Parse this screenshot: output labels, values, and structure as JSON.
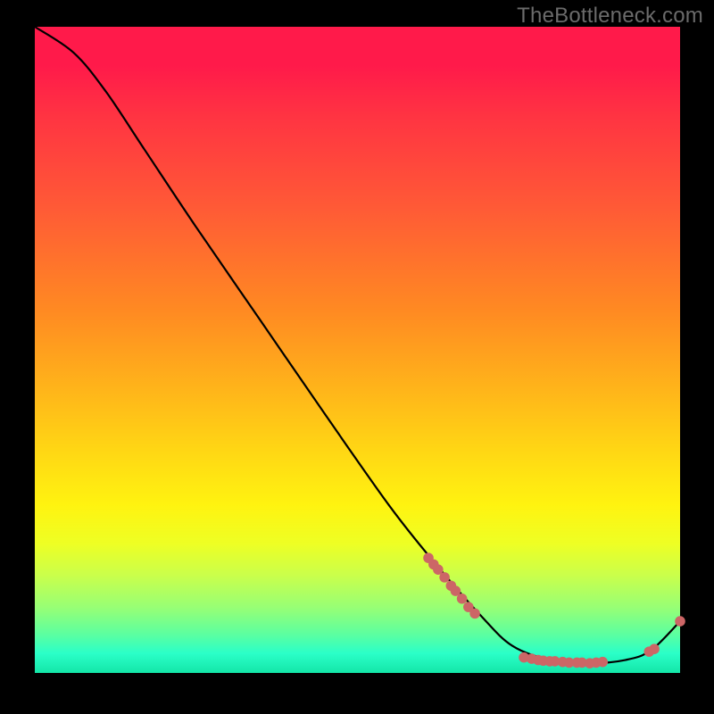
{
  "watermark": "TheBottleneck.com",
  "chart_data": {
    "type": "line",
    "title": "",
    "xlabel": "",
    "ylabel": "",
    "xlim": [
      0,
      1
    ],
    "ylim": [
      0,
      1
    ],
    "curve": [
      {
        "x": 0.0,
        "y": 1.0
      },
      {
        "x": 0.06,
        "y": 0.96
      },
      {
        "x": 0.11,
        "y": 0.9
      },
      {
        "x": 0.17,
        "y": 0.81
      },
      {
        "x": 0.25,
        "y": 0.69
      },
      {
        "x": 0.35,
        "y": 0.545
      },
      {
        "x": 0.45,
        "y": 0.4
      },
      {
        "x": 0.55,
        "y": 0.258
      },
      {
        "x": 0.62,
        "y": 0.17
      },
      {
        "x": 0.69,
        "y": 0.09
      },
      {
        "x": 0.74,
        "y": 0.042
      },
      {
        "x": 0.8,
        "y": 0.02
      },
      {
        "x": 0.86,
        "y": 0.015
      },
      {
        "x": 0.915,
        "y": 0.02
      },
      {
        "x": 0.955,
        "y": 0.035
      },
      {
        "x": 1.0,
        "y": 0.08
      }
    ],
    "markers": [
      {
        "x": 0.61,
        "y": 0.178
      },
      {
        "x": 0.618,
        "y": 0.168
      },
      {
        "x": 0.625,
        "y": 0.16
      },
      {
        "x": 0.635,
        "y": 0.148
      },
      {
        "x": 0.645,
        "y": 0.135
      },
      {
        "x": 0.652,
        "y": 0.127
      },
      {
        "x": 0.662,
        "y": 0.115
      },
      {
        "x": 0.672,
        "y": 0.102
      },
      {
        "x": 0.682,
        "y": 0.092
      },
      {
        "x": 0.758,
        "y": 0.024
      },
      {
        "x": 0.77,
        "y": 0.022
      },
      {
        "x": 0.78,
        "y": 0.02
      },
      {
        "x": 0.788,
        "y": 0.019
      },
      {
        "x": 0.798,
        "y": 0.018
      },
      {
        "x": 0.806,
        "y": 0.018
      },
      {
        "x": 0.818,
        "y": 0.017
      },
      {
        "x": 0.828,
        "y": 0.016
      },
      {
        "x": 0.84,
        "y": 0.016
      },
      {
        "x": 0.848,
        "y": 0.016
      },
      {
        "x": 0.86,
        "y": 0.015
      },
      {
        "x": 0.87,
        "y": 0.016
      },
      {
        "x": 0.88,
        "y": 0.017
      },
      {
        "x": 0.952,
        "y": 0.033
      },
      {
        "x": 0.96,
        "y": 0.037
      },
      {
        "x": 1.0,
        "y": 0.08
      }
    ],
    "marker_style": {
      "color": "#cc6666",
      "radius_norm": 0.008
    }
  }
}
